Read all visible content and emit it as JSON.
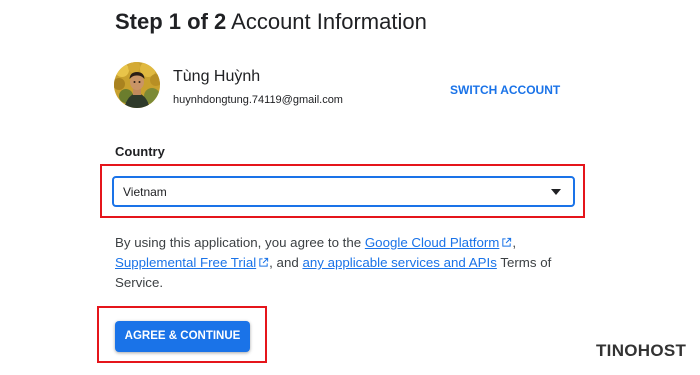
{
  "header": {
    "step": "Step 1 of 2",
    "title": "Account Information"
  },
  "account": {
    "name": "Tùng Huỳnh",
    "email": "huynhdongtung.74119@gmail.com",
    "switch_label": "SWITCH ACCOUNT"
  },
  "country": {
    "label": "Country",
    "selected": "Vietnam"
  },
  "terms": {
    "prefix": "By using this application, you agree to the ",
    "link1": "Google Cloud Platform",
    "sep1": ",",
    "link2": "Supplemental Free Trial",
    "sep2": ", and ",
    "link3": "any applicable services and APIs",
    "suffix": " Terms of Service."
  },
  "actions": {
    "agree_label": "AGREE & CONTINUE"
  },
  "watermark": {
    "text": "TINOHOST"
  },
  "colors": {
    "accent": "#1a73e8",
    "highlight": "#e5151b",
    "text": "#202124"
  },
  "icons": {
    "external_link": "external-link-icon",
    "dropdown": "dropdown-arrow-icon"
  }
}
